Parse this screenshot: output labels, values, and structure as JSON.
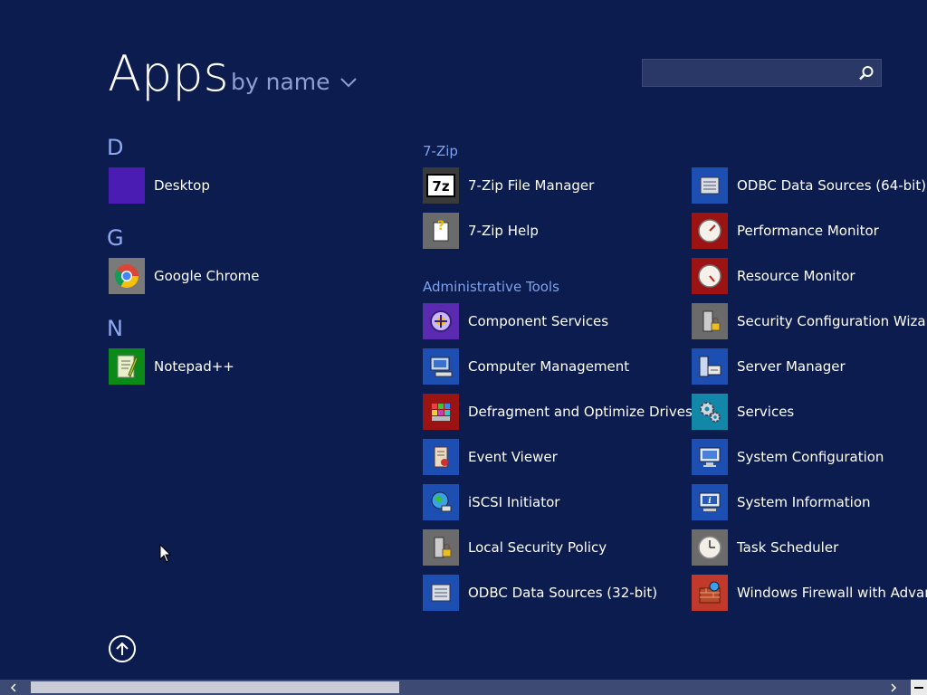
{
  "header": {
    "title": "Apps",
    "sort_label": "by name",
    "search_placeholder": ""
  },
  "groups": {
    "d": "D",
    "g": "G",
    "n": "N",
    "sevenzip": "7-Zip",
    "admin": "Administrative Tools"
  },
  "apps": {
    "desktop": "Desktop",
    "chrome": "Google Chrome",
    "notepadpp": "Notepad++",
    "zip_fm": "7-Zip File Manager",
    "zip_help": "7-Zip Help",
    "component_services": "Component Services",
    "computer_management": "Computer Management",
    "defrag": "Defragment and Optimize Drives",
    "event_viewer": "Event Viewer",
    "iscsi": "iSCSI Initiator",
    "local_security": "Local Security Policy",
    "odbc32": "ODBC Data Sources (32-bit)",
    "odbc64": "ODBC Data Sources (64-bit)",
    "perfmon": "Performance Monitor",
    "resmon": "Resource Monitor",
    "scw": "Security Configuration Wizard",
    "server_manager": "Server Manager",
    "services": "Services",
    "msconfig": "System Configuration",
    "msinfo": "System Information",
    "task_scheduler": "Task Scheduler",
    "firewall": "Windows Firewall with Advanced"
  },
  "colors": {
    "background": "#0c1c4e",
    "accent_text": "#8fa9f0",
    "desktop_tile": "#4b1cb3",
    "chrome_tile": "#7a7a7a",
    "notepad_tile": "#0b8a1a",
    "zip_tile": "#3a3a3a",
    "admin_blue_tile": "#1d4fb3",
    "admin_red_tile": "#9b1313",
    "admin_gray_tile": "#6b6b6b",
    "admin_teal_tile": "#1387a8",
    "admin_purple_tile": "#5a2bb0"
  },
  "icons": {
    "desktop": "desktop-icon",
    "chrome": "chrome-icon",
    "notepadpp": "notepadpp-icon",
    "search": "search-icon",
    "up": "arrow-up-icon",
    "chevron": "chevron-down-icon"
  }
}
